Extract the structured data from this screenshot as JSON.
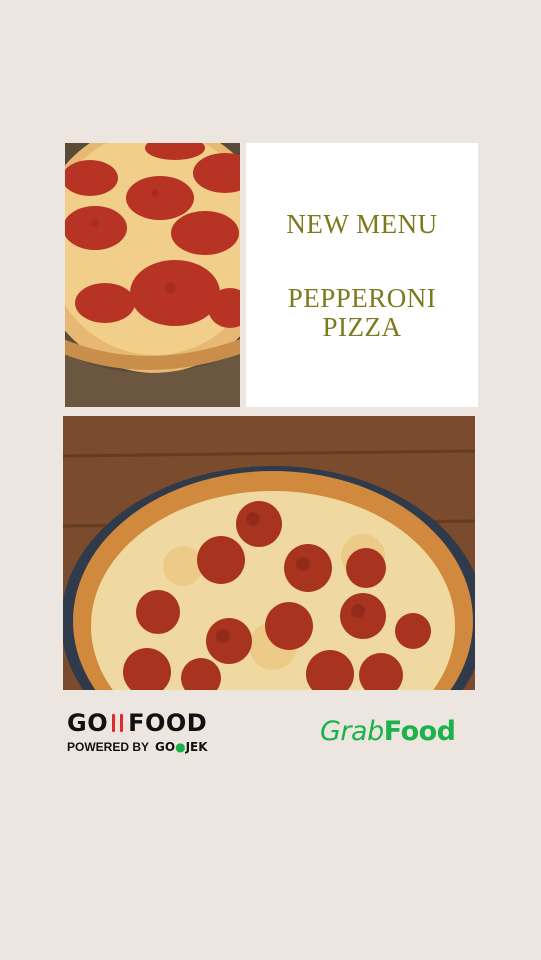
{
  "title_card": {
    "line1": "NEW MENU",
    "line2a": "PEPPERONI",
    "line2b": "PIZZA"
  },
  "logos": {
    "gofood_word_left": "GO",
    "gofood_word_right": "FOOD",
    "gofood_powered": "POWERED BY",
    "gojek_left": "GO",
    "gojek_right": "JEK",
    "grab_prefix": "Grab",
    "grab_suffix": "Food"
  },
  "colors": {
    "background": "#ede5e0",
    "title_text": "#7d7a1e",
    "grab_green": "#1ab24a",
    "gofood_red": "#e0282e"
  }
}
